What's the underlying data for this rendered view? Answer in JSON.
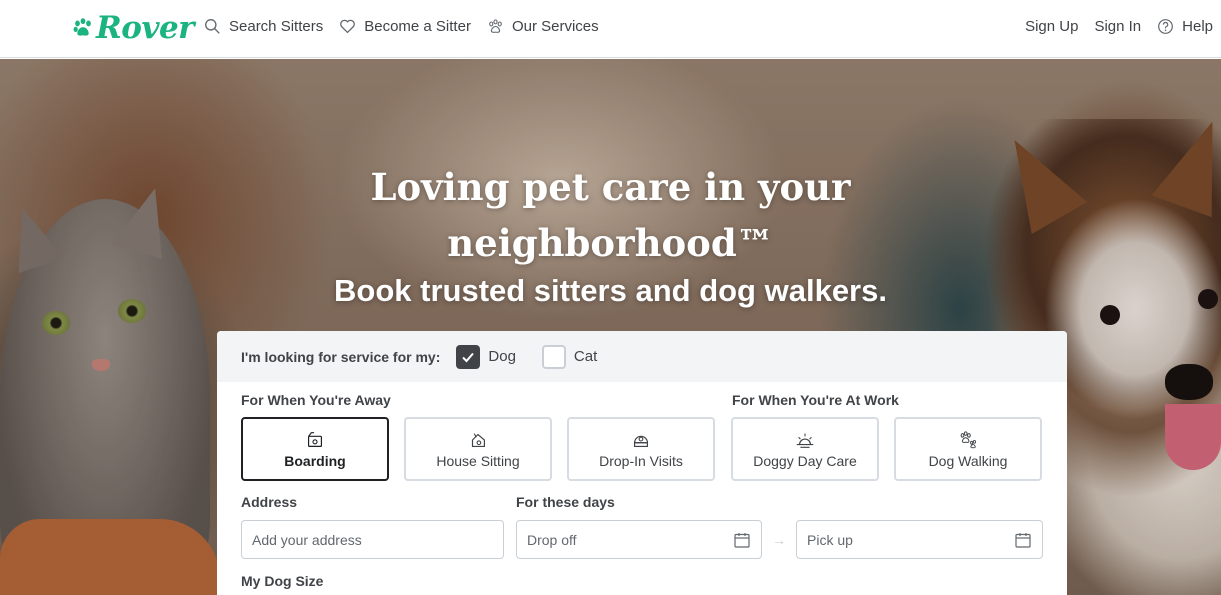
{
  "brand": {
    "name": "Rover",
    "color": "#1bb380"
  },
  "nav": {
    "left": [
      {
        "label": "Search Sitters",
        "icon": "search-icon"
      },
      {
        "label": "Become a Sitter",
        "icon": "heart-icon"
      },
      {
        "label": "Our Services",
        "icon": "paw-icon"
      }
    ],
    "right": [
      {
        "label": "Sign Up"
      },
      {
        "label": "Sign In"
      },
      {
        "label": "Help",
        "icon": "help-icon"
      }
    ]
  },
  "hero": {
    "title": "Loving pet care in your neighborhood™",
    "subtitle": "Book trusted sitters and dog walkers."
  },
  "search": {
    "pet_question": "I'm looking for service for my:",
    "pets": [
      {
        "label": "Dog",
        "checked": true
      },
      {
        "label": "Cat",
        "checked": false
      }
    ],
    "away_label": "For When You're Away",
    "work_label": "For When You're At Work",
    "services": [
      {
        "label": "Boarding",
        "icon": "boarding-icon",
        "selected": true
      },
      {
        "label": "House Sitting",
        "icon": "house-sitting-icon",
        "selected": false
      },
      {
        "label": "Drop-In Visits",
        "icon": "drop-in-icon",
        "selected": false
      },
      {
        "label": "Doggy Day Care",
        "icon": "day-care-icon",
        "selected": false
      },
      {
        "label": "Dog Walking",
        "icon": "dog-walking-icon",
        "selected": false
      }
    ],
    "address_label": "Address",
    "address_placeholder": "Add your address",
    "days_label": "For these days",
    "dropoff_placeholder": "Drop off",
    "pickup_placeholder": "Pick up",
    "dog_size_label": "My Dog Size"
  }
}
